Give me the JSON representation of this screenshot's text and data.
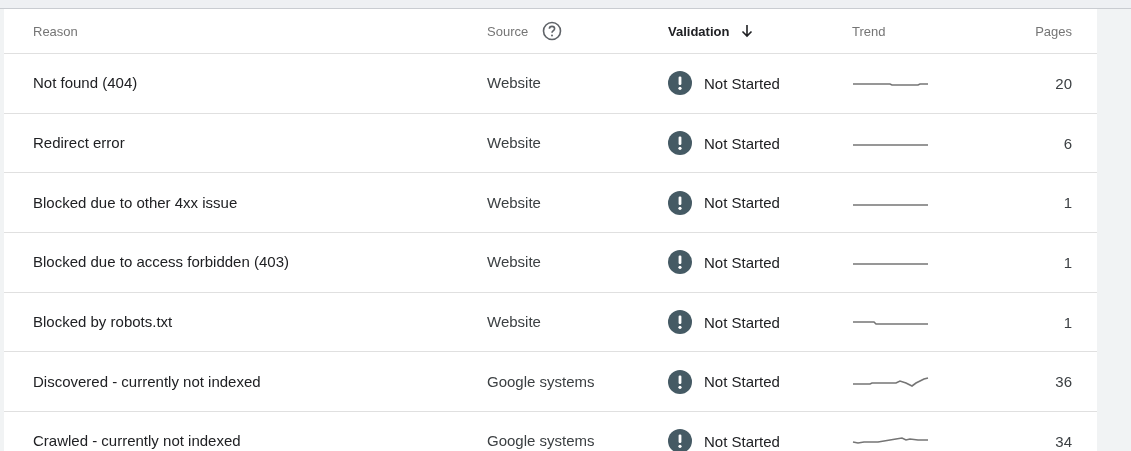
{
  "table": {
    "columns": [
      {
        "label": "Reason",
        "sorted": false,
        "help": false
      },
      {
        "label": "Source",
        "sorted": false,
        "help": true
      },
      {
        "label": "Validation",
        "sorted": true,
        "help": false
      },
      {
        "label": "Trend",
        "sorted": false,
        "help": false
      },
      {
        "label": "Pages",
        "sorted": false,
        "help": false
      }
    ],
    "rows": [
      {
        "reason": "Not found (404)",
        "source": "Website",
        "validation": "Not Started",
        "pages": "20"
      },
      {
        "reason": "Redirect error",
        "source": "Website",
        "validation": "Not Started",
        "pages": "6"
      },
      {
        "reason": "Blocked due to other 4xx issue",
        "source": "Website",
        "validation": "Not Started",
        "pages": "1"
      },
      {
        "reason": "Blocked due to access forbidden (403)",
        "source": "Website",
        "validation": "Not Started",
        "pages": "1"
      },
      {
        "reason": "Blocked by robots.txt",
        "source": "Website",
        "validation": "Not Started",
        "pages": "1"
      },
      {
        "reason": "Discovered - currently not indexed",
        "source": "Google systems",
        "validation": "Not Started",
        "pages": "36"
      },
      {
        "reason": "Crawled - currently not indexed",
        "source": "Google systems",
        "validation": "Not Started",
        "pages": "34"
      }
    ]
  }
}
